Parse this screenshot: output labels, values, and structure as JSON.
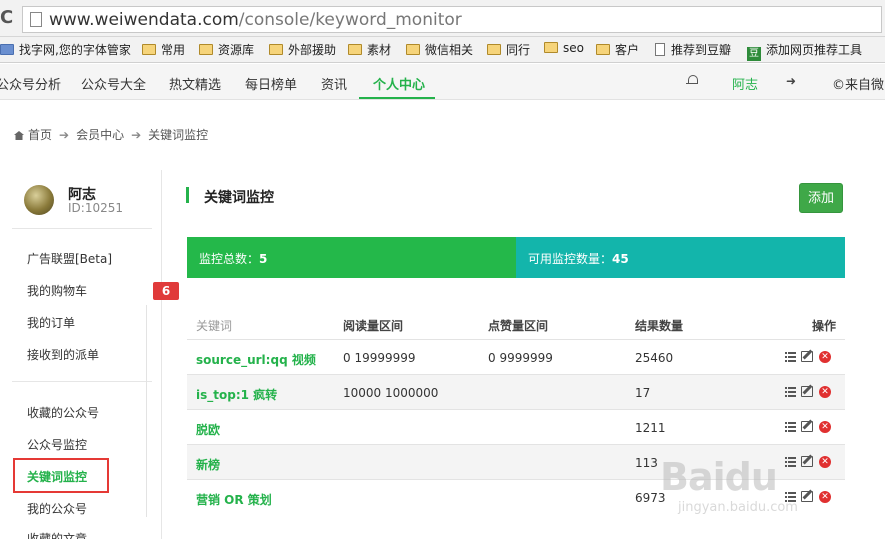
{
  "browser": {
    "url_host": "www.weiwendata.com",
    "url_path": "/console/keyword_monitor",
    "bookmarks": [
      {
        "label": "找字网,您的字体管家",
        "kind": "site"
      },
      {
        "label": "常用",
        "kind": "folder"
      },
      {
        "label": "资源库",
        "kind": "folder"
      },
      {
        "label": "外部援助",
        "kind": "folder"
      },
      {
        "label": "素材",
        "kind": "folder"
      },
      {
        "label": "微信相关",
        "kind": "folder"
      },
      {
        "label": "同行",
        "kind": "folder"
      },
      {
        "label": "seo",
        "kind": "folder"
      },
      {
        "label": "客户",
        "kind": "folder"
      },
      {
        "label": "推荐到豆瓣",
        "kind": "page"
      },
      {
        "label": "添加网页推荐工具",
        "kind": "douban"
      }
    ]
  },
  "nav": {
    "items": [
      "公众号分析",
      "公众号大全",
      "热文精选",
      "每日榜单",
      "资讯",
      "个人中心"
    ],
    "active_index": 5,
    "user": "阿志",
    "right_text": "©来自微问"
  },
  "breadcrumb": [
    "首页",
    "会员中心",
    "关键词监控"
  ],
  "sidebar": {
    "user_name": "阿志",
    "user_id": "ID:10251",
    "group1": [
      "广告联盟[Beta]",
      "我的购物车",
      "我的订单",
      "接收到的派单"
    ],
    "cart_badge": "6",
    "group2": [
      "收藏的公众号",
      "公众号监控",
      "关键词监控",
      "我的公众号",
      "收藏的文章"
    ],
    "active_label": "关键词监控"
  },
  "main": {
    "title": "关键词监控",
    "add_label": "添加",
    "stats": {
      "total_label": "监控总数：",
      "total_value": "5",
      "available_label": "可用监控数量：",
      "available_value": "45"
    },
    "table": {
      "headers": [
        "关键词",
        "阅读量区间",
        "点赞量区间",
        "结果数量",
        "操作"
      ],
      "rows": [
        {
          "keyword": "source_url:qq 视频",
          "read_range": "0 19999999",
          "like_range": "0 9999999",
          "results": "25460"
        },
        {
          "keyword": "is_top:1 疯转",
          "read_range": "10000 1000000",
          "like_range": "",
          "results": "17"
        },
        {
          "keyword": "脱欧",
          "read_range": "",
          "like_range": "",
          "results": "1211"
        },
        {
          "keyword": "新榜",
          "read_range": "",
          "like_range": "",
          "results": "113"
        },
        {
          "keyword": "营销 OR 策划",
          "read_range": "",
          "like_range": "",
          "results": "6973"
        }
      ]
    }
  },
  "colors": {
    "brand_green": "#24b24b",
    "teal": "#13b5ab",
    "badge_red": "#e03a3a"
  },
  "watermark": {
    "brand": "Baidu",
    "sub": "jingyan.baidu.com"
  }
}
